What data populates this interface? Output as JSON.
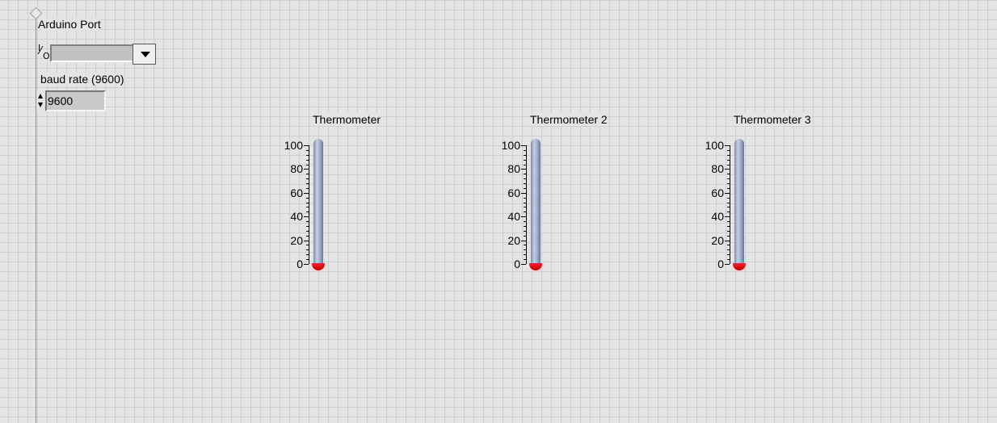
{
  "port": {
    "label": "Arduino Port",
    "value": "",
    "glyph_top": "I",
    "glyph_slash": "⁄",
    "glyph_bottom": "O"
  },
  "baud": {
    "label": "baud rate (9600)",
    "value": "9600"
  },
  "thermometers": [
    {
      "title": "Thermometer",
      "value": 0,
      "min": 0,
      "max": 100,
      "ticks": [
        "100",
        "80",
        "60",
        "40",
        "20",
        "0"
      ]
    },
    {
      "title": "Thermometer 2",
      "value": 0,
      "min": 0,
      "max": 100,
      "ticks": [
        "100",
        "80",
        "60",
        "40",
        "20",
        "0"
      ]
    },
    {
      "title": "Thermometer 3",
      "value": 0,
      "min": 0,
      "max": 100,
      "ticks": [
        "100",
        "80",
        "60",
        "40",
        "20",
        "0"
      ]
    }
  ],
  "colors": {
    "mercury": "#e00000",
    "tube": "#aab4d2",
    "panel": "#e4e4e4"
  }
}
